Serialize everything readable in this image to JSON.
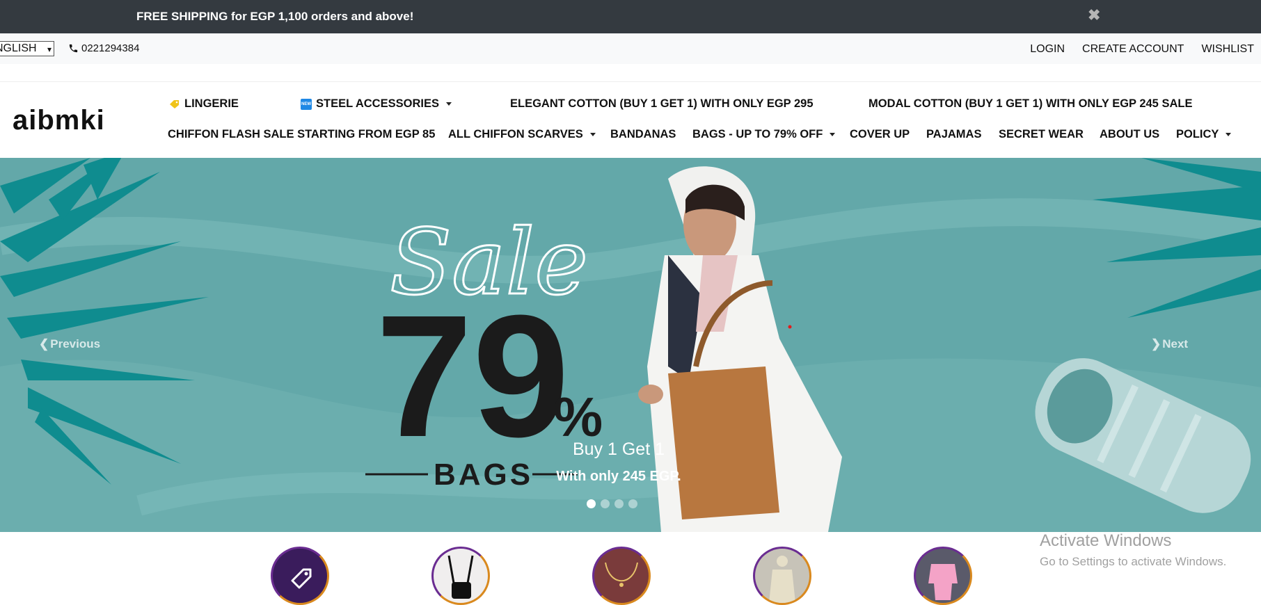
{
  "announcement": {
    "text": "FREE SHIPPING for EGP 1,100 orders and above!",
    "close_icon": "close-icon"
  },
  "topbar": {
    "language": "NGLISH",
    "phone": "0221294384",
    "links": {
      "login": "LOGIN",
      "create_account": "CREATE ACCOUNT",
      "wishlist": "WISHLIST"
    }
  },
  "header": {
    "logo_text": "aibmki",
    "nav_row1": {
      "lingerie": "LINGERIE",
      "steel": "STEEL ACCESSORIES",
      "elegant": "ELEGANT COTTON (BUY 1 GET 1) WITH ONLY EGP 295",
      "modal": "MODAL COTTON (BUY 1 GET 1) WITH ONLY EGP 245 SALE"
    },
    "nav_row2": {
      "chiffon_flash": "CHIFFON FLASH SALE STARTING FROM EGP 85",
      "all_chiffon": "ALL CHIFFON SCARVES",
      "bandanas": "BANDANAS",
      "bags": "BAGS - UP TO 79% OFF",
      "cover_up": "COVER UP",
      "pajamas": "PAJAMAS",
      "secret_wear": "SECRET WEAR",
      "about": "ABOUT US",
      "policy": "POLICY"
    },
    "new_badge": "NEW"
  },
  "hero": {
    "sale_script": "Sale",
    "percent_number": "79",
    "percent_sign": "%",
    "bags_word": "BAGS",
    "caption_title": "Buy 1 Get 1",
    "caption_text": "With only 245 EGP.",
    "previous": "Previous",
    "next": "Next",
    "slide_count": 4,
    "active_slide": 1,
    "colors": {
      "background": "#63a8a9",
      "leaf": "#0f8c8f"
    }
  },
  "watermark": {
    "title": "Activate Windows",
    "subtitle": "Go to Settings to activate Windows."
  }
}
